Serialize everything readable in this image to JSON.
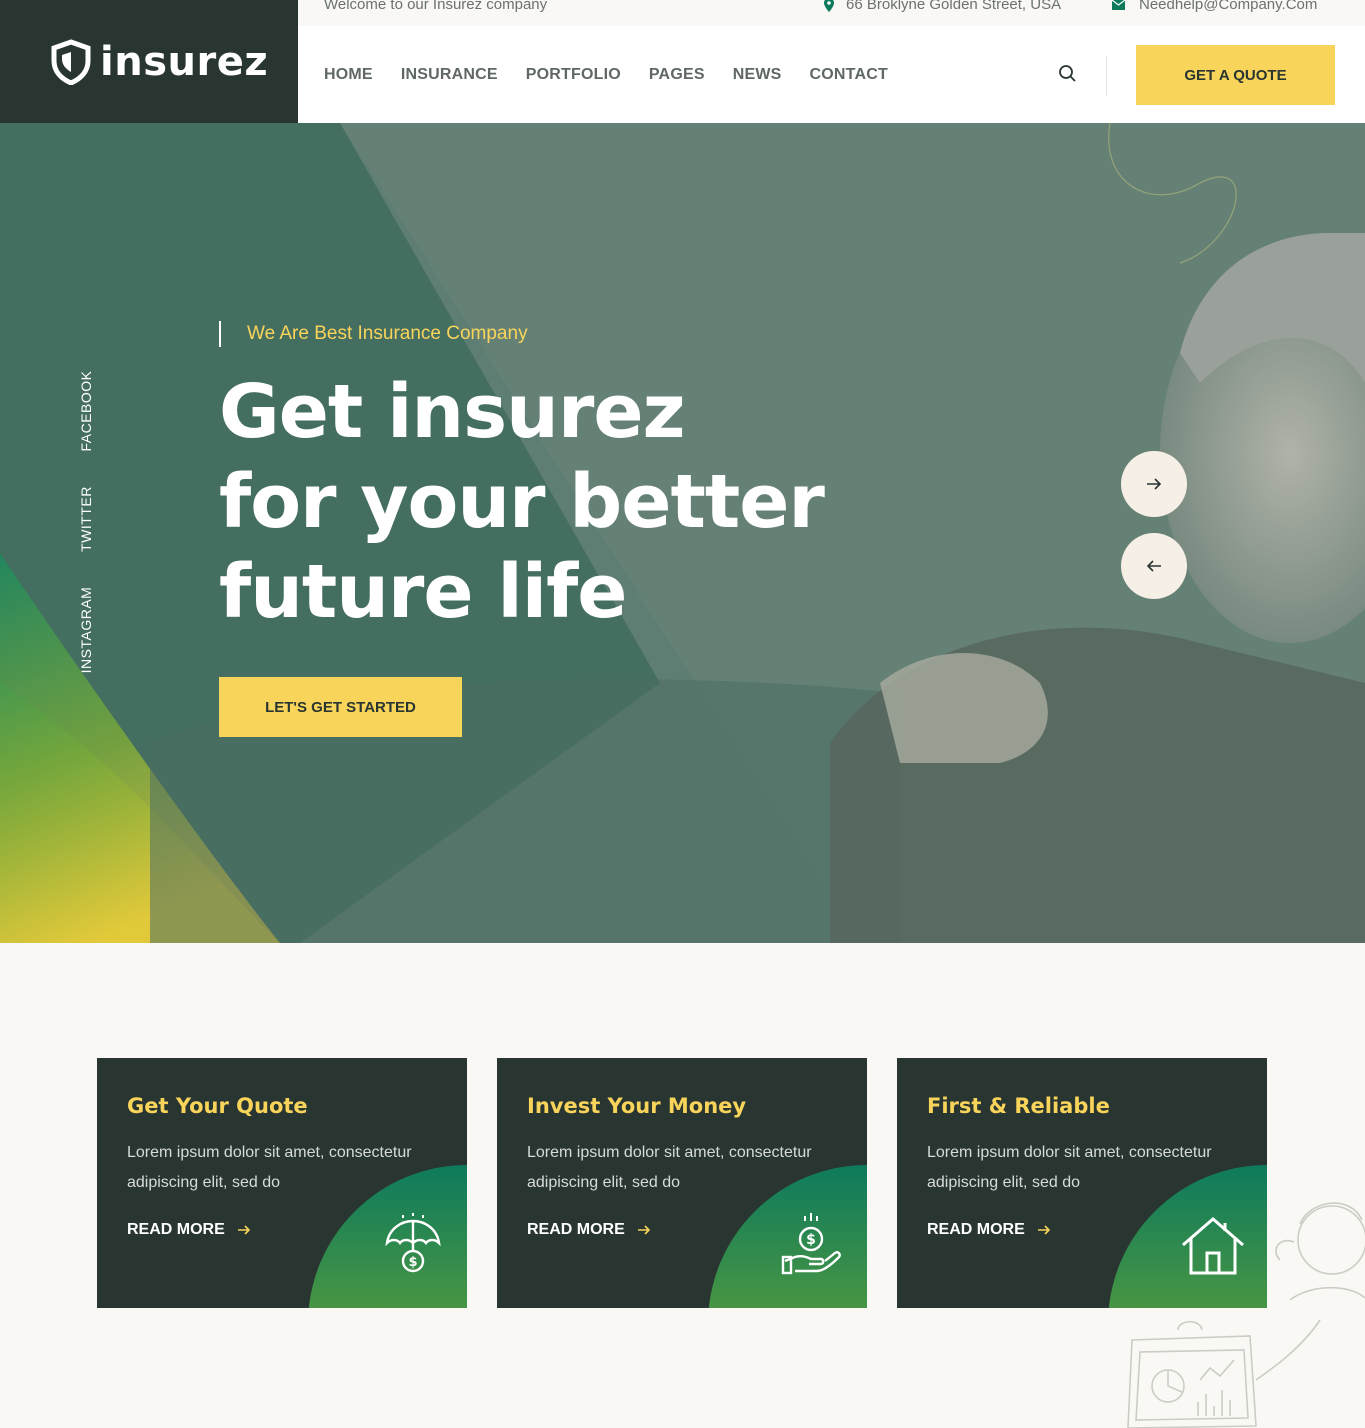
{
  "brand": {
    "name": "insurez"
  },
  "topbar": {
    "welcome": "Welcome to our Insurez company",
    "address": "66 Broklyne Golden Street, USA",
    "email": "Needhelp@Company.Com"
  },
  "nav": {
    "items": [
      "HOME",
      "INSURANCE",
      "PORTFOLIO",
      "PAGES",
      "NEWS",
      "CONTACT"
    ],
    "quote_label": "GET A QUOTE"
  },
  "hero": {
    "tagline": "We Are Best Insurance Company",
    "headline": [
      "Get insurez",
      "for your better",
      "future life"
    ],
    "cta_label": "LET'S GET STARTED",
    "social": [
      "FACEBOOK",
      "TWITTER",
      "INSTAGRAM"
    ]
  },
  "features": [
    {
      "title": "Get Your Quote",
      "text": "Lorem ipsum dolor sit amet, consectetur adipiscing elit, sed do",
      "link": "READ MORE",
      "icon": "umbrella-dollar-icon"
    },
    {
      "title": "Invest Your Money",
      "text": "Lorem ipsum dolor sit amet, consectetur adipiscing elit, sed do",
      "link": "READ MORE",
      "icon": "hand-coin-icon"
    },
    {
      "title": "First & Reliable",
      "text": "Lorem ipsum dolor sit amet, consectetur adipiscing elit, sed do",
      "link": "READ MORE",
      "icon": "house-icon"
    }
  ],
  "colors": {
    "dark": "#283530",
    "accent": "#f9d45a",
    "green": "#0e7a5c",
    "cream": "#f9f8f4"
  }
}
